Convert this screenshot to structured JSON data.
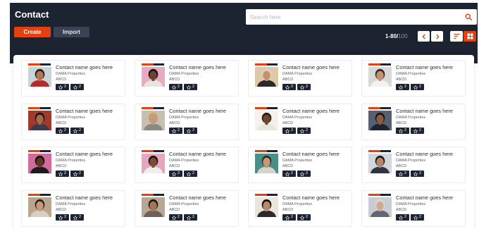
{
  "header": {
    "title": "Contact",
    "create_label": "Create",
    "import_label": "Import",
    "search_placeholder": "Search here",
    "pager_range": "1-80/",
    "pager_total": "100"
  },
  "colors": {
    "brand": "#e3410f",
    "navy": "#1c2431"
  },
  "icons": {
    "search": "search-icon",
    "prev": "chevron-left-icon",
    "next": "chevron-right-icon",
    "list_view": "sort-list-icon",
    "grid_view": "grid-icon",
    "rating": "star-icon",
    "favorite": "star-outline-icon"
  },
  "contacts": [
    {
      "name": "Contact name goes here",
      "company": "DAMA Properties",
      "code": "ABCD",
      "badge1": "2",
      "badge2": "2",
      "bg": "#c9d4d9",
      "skin": "#b5745a",
      "hair": "#2b1d16",
      "shirt": "#b52a2a"
    },
    {
      "name": "Contact name goes here",
      "company": "DAMA Properties",
      "code": "ABCD",
      "badge1": "2",
      "badge2": "2",
      "bg": "#e8a9c2",
      "skin": "#6b4330",
      "hair": "#1a120e",
      "shirt": "#e8e4e0"
    },
    {
      "name": "Contact name goes here",
      "company": "DAMA Properties",
      "code": "ABCD",
      "badge1": "2",
      "badge2": "2",
      "bg": "#dcc9a8",
      "skin": "#c98e6c",
      "hair": "#d9d2c2",
      "shirt": "#2a2a2a"
    },
    {
      "name": "Contact name goes here",
      "company": "DAMA Properties",
      "code": "ABCD",
      "badge1": "2",
      "badge2": "2",
      "bg": "#d8d8d8",
      "skin": "#c4906f",
      "hair": "#3a2a20",
      "shirt": "#f2f2f2"
    },
    {
      "name": "Contact name goes here",
      "company": "DAMA Properties",
      "code": "ABCD",
      "badge1": "2",
      "badge2": "2",
      "bg": "#a03a2c",
      "skin": "#a86a4c",
      "hair": "#1e1512",
      "shirt": "#3b3b4a"
    },
    {
      "name": "Contact name goes here",
      "company": "DAMA Properties",
      "code": "ABCD",
      "badge1": "2",
      "badge2": "2",
      "bg": "#c8bfb2",
      "skin": "#c49a7e",
      "hair": "#c7a46a",
      "shirt": "#8a8a82"
    },
    {
      "name": "Contact name goes here",
      "company": "DAMA Properties",
      "code": "ABCD",
      "badge1": "2",
      "badge2": "2",
      "bg": "#f4f1ec",
      "skin": "#6e4530",
      "hair": "#2a1a10",
      "shirt": "#e9e6e0"
    },
    {
      "name": "Contact name goes here",
      "company": "DAMA Properties",
      "code": "ABCD",
      "badge1": "2",
      "badge2": "2",
      "bg": "#556070",
      "skin": "#8e5a40",
      "hair": "#1b1411",
      "shirt": "#1e2430"
    },
    {
      "name": "Contact name goes here",
      "company": "DAMA Properties",
      "code": "ABCD",
      "badge1": "2",
      "badge2": "2",
      "bg": "#d36a9c",
      "skin": "#5a3728",
      "hair": "#141010",
      "shirt": "#1b1b1b"
    },
    {
      "name": "Contact name goes here",
      "company": "DAMA Properties",
      "code": "ABCD",
      "badge1": "2",
      "badge2": "2",
      "bg": "#e4a7c0",
      "skin": "#7a4c36",
      "hair": "#1a120e",
      "shirt": "#f1efea"
    },
    {
      "name": "Contact name goes here",
      "company": "DAMA Properties",
      "code": "ABCD",
      "badge1": "2",
      "badge2": "2",
      "bg": "#4a8f86",
      "skin": "#c89878",
      "hair": "#3a281c",
      "shirt": "#d8d2c8"
    },
    {
      "name": "Contact name goes here",
      "company": "DAMA Properties",
      "code": "ABCD",
      "badge1": "2",
      "badge2": "2",
      "bg": "#cfd6dc",
      "skin": "#b88666",
      "hair": "#1f1a18",
      "shirt": "#2e3440"
    },
    {
      "name": "Contact name goes here",
      "company": "DAMA Properties",
      "code": "ABCD",
      "badge1": "2",
      "badge2": "2",
      "bg": "#b9a690",
      "skin": "#c79a7c",
      "hair": "#2d1f18",
      "shirt": "#d9d0c4"
    },
    {
      "name": "Contact name goes here",
      "company": "DAMA Properties",
      "code": "ABCD",
      "badge1": "2",
      "badge2": "2",
      "bg": "#b8a794",
      "skin": "#a87556",
      "hair": "#1e1814",
      "shirt": "#6c6258"
    },
    {
      "name": "Contact name goes here",
      "company": "DAMA Properties",
      "code": "ABCD",
      "badge1": "2",
      "badge2": "2",
      "bg": "#e9e5de",
      "skin": "#b98a6a",
      "hair": "#141211",
      "shirt": "#2e2a28"
    },
    {
      "name": "Contact name goes here",
      "company": "DAMA Properties",
      "code": "ABCD",
      "badge1": "2",
      "badge2": "2",
      "bg": "#c7cdd3",
      "skin": "#d2aa90",
      "hair": "#d8d8d8",
      "shirt": "#5e6874"
    }
  ]
}
